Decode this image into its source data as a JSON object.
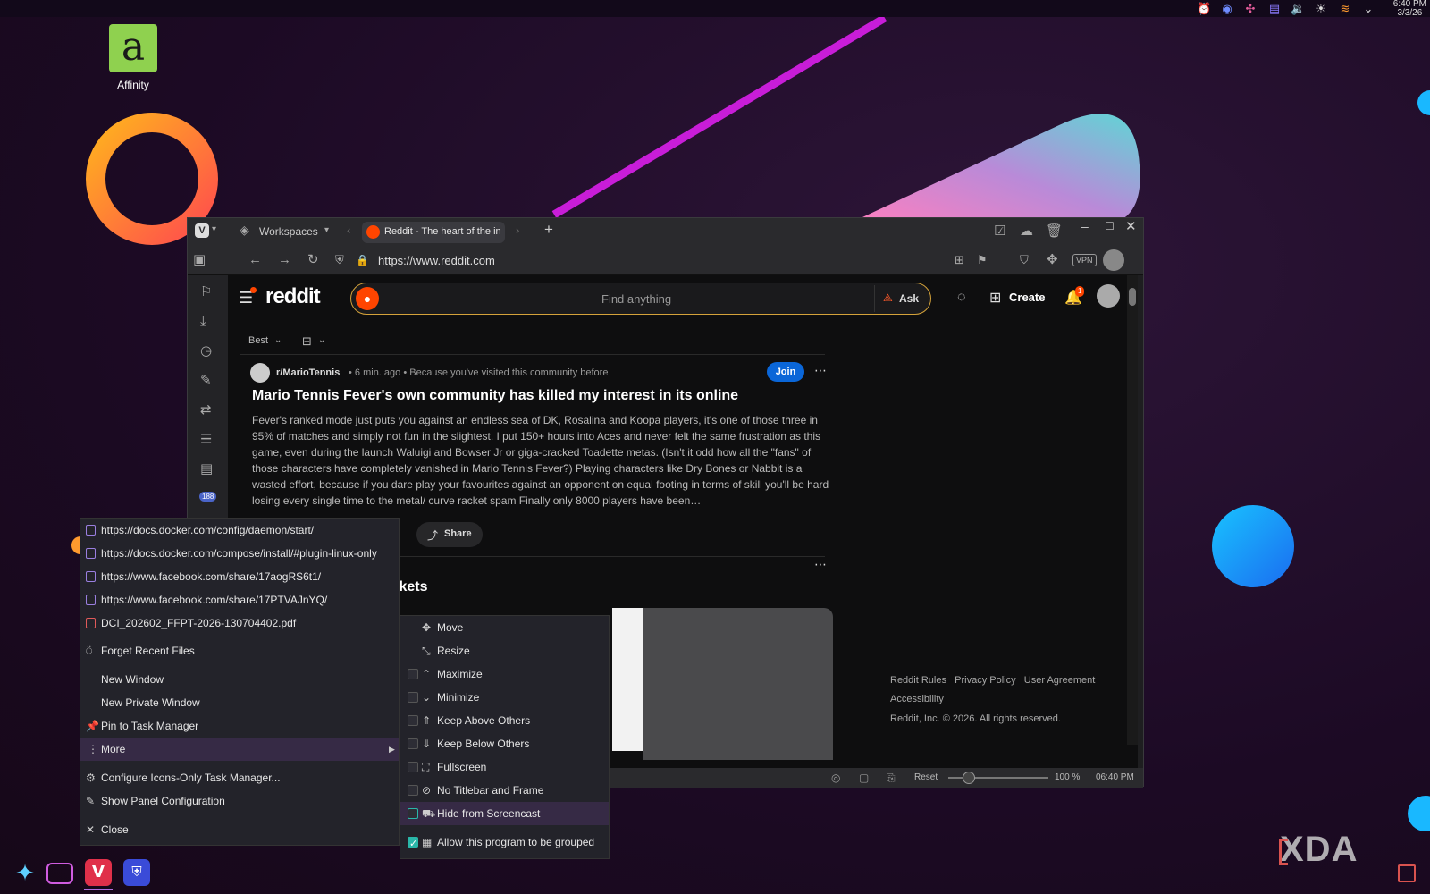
{
  "desktop": {
    "icon_label": "Affinity",
    "clock_time": "6:40 PM",
    "clock_date": "3/3/26",
    "watermark": "XDA"
  },
  "browser": {
    "workspaces_label": "Workspaces",
    "tab_title": "Reddit - The heart of the in",
    "url": "https://www.reddit.com",
    "vpn_label": "VPN",
    "status": {
      "reset_label": "Reset",
      "zoom": "100 %",
      "time": "06:40 PM"
    },
    "panel_badge": "188"
  },
  "reddit": {
    "logo_text": "reddit",
    "search_placeholder": "Find anything",
    "ask_label": "Ask",
    "create_label": "Create",
    "notif_count": "1",
    "sort_label": "Best",
    "post": {
      "subreddit": "r/MarioTennis",
      "meta": "• 6 min. ago • Because you've visited this community before",
      "join_label": "Join",
      "title": "Mario Tennis Fever's own community has killed my interest in its online",
      "body": "Fever's ranked mode just puts you against an endless sea of DK, Rosalina and Koopa players, it's one of those three in 95% of matches and simply not fun in the slightest. I put 150+ hours into Aces and never felt the same frustration as this game, even during the launch Waluigi and Bowser Jr or giga-cracked Toadette metas. (Isn't it odd how all the \"fans\" of those characters have completely vanished in Mario Tennis Fever?)  Playing characters like Dry Bones or Nabbit is a wasted effort, because if you dare play your favourites against an opponent on equal footing in terms of skill you'll be hard losing every single time to the metal/ curve racket spam  Finally only 8000 players have been…",
      "share_label": "Share"
    },
    "post2_title_fragment": "m Tickets",
    "footer": {
      "links": [
        "Reddit Rules",
        "Privacy Policy",
        "User Agreement"
      ],
      "accessibility": "Accessibility",
      "copyright": "Reddit, Inc. © 2026. All rights reserved."
    }
  },
  "context_menu": {
    "recent": [
      "https://docs.docker.com/config/daemon/start/",
      "https://docs.docker.com/compose/install/#plugin-linux-only",
      "https://www.facebook.com/share/17aogRS6t1/",
      "https://www.facebook.com/share/17PTVAJnYQ/",
      "DCI_202602_FFPT-2026-130704402.pdf"
    ],
    "forget": "Forget Recent Files",
    "new_window": "New Window",
    "new_private": "New Private Window",
    "pin": "Pin to Task Manager",
    "more": "More",
    "configure": "Configure Icons-Only Task Manager...",
    "show_panel": "Show Panel Configuration",
    "close": "Close"
  },
  "submenu": {
    "move": "Move",
    "resize": "Resize",
    "maximize": "Maximize",
    "minimize": "Minimize",
    "keep_above": "Keep Above Others",
    "keep_below": "Keep Below Others",
    "fullscreen": "Fullscreen",
    "no_titlebar": "No Titlebar and Frame",
    "hide_screencast": "Hide from Screencast",
    "allow_grouped": "Allow this program to be grouped"
  },
  "colors": {
    "accent": "#2ab7a9",
    "reddit_orange": "#ff4500",
    "join_blue": "#0a66d8"
  }
}
